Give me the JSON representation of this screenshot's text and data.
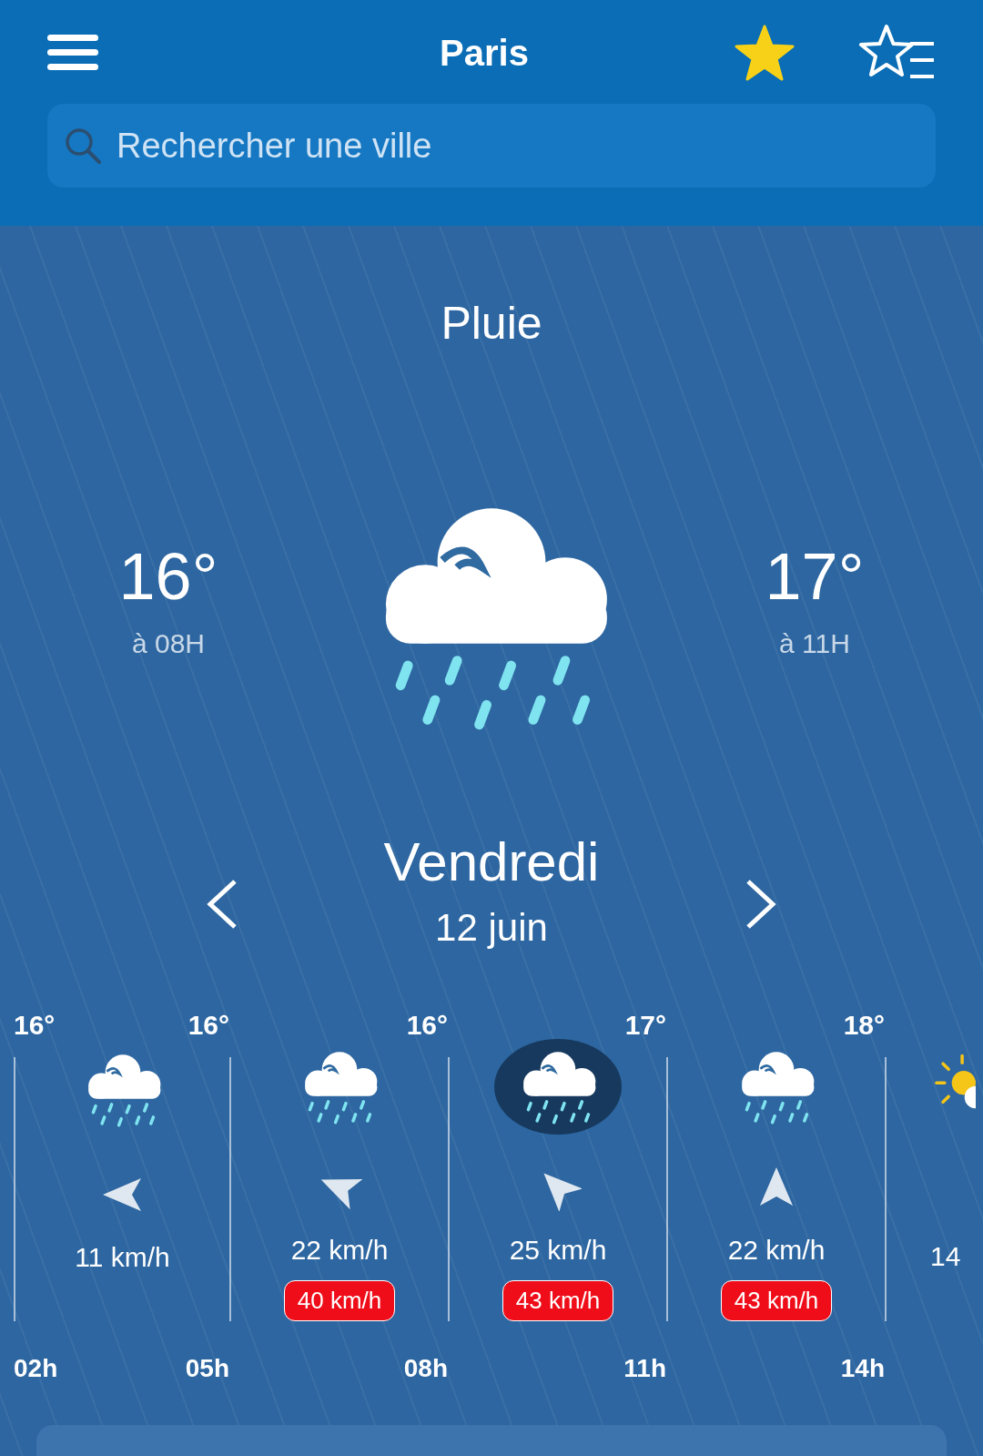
{
  "header": {
    "title": "Paris",
    "favorite": true
  },
  "search": {
    "placeholder": "Rechercher une ville"
  },
  "current": {
    "condition": "Pluie",
    "kind": "rain",
    "min": {
      "temp": "16°",
      "time": "à 08H"
    },
    "max": {
      "temp": "17°",
      "time": "à 11H"
    }
  },
  "day": {
    "name": "Vendredi",
    "date": "12 juin"
  },
  "hourly_points": [
    {
      "temp": "16°",
      "time": "02h"
    },
    {
      "temp": "16°",
      "time": "05h"
    },
    {
      "temp": "16°",
      "time": "08h"
    },
    {
      "temp": "17°",
      "time": "11h"
    },
    {
      "temp": "18°",
      "time": "14h"
    }
  ],
  "hourly_columns": [
    {
      "kind": "rain",
      "arrow": {
        "kind": "west"
      },
      "wind": "11 km/h",
      "selected": false
    },
    {
      "kind": "rain",
      "arrow": {
        "kind": "westnorthwest"
      },
      "wind": "22 km/h",
      "gust": "40 km/h",
      "selected": false
    },
    {
      "kind": "rain",
      "arrow": {
        "kind": "northwest"
      },
      "wind": "25 km/h",
      "gust": "43 km/h",
      "selected": true
    },
    {
      "kind": "rain",
      "arrow": {
        "kind": "north"
      },
      "wind": "22 km/h",
      "gust": "43 km/h",
      "selected": false
    },
    {
      "kind": "sun_cloud",
      "wind": "14",
      "selected": false
    }
  ]
}
